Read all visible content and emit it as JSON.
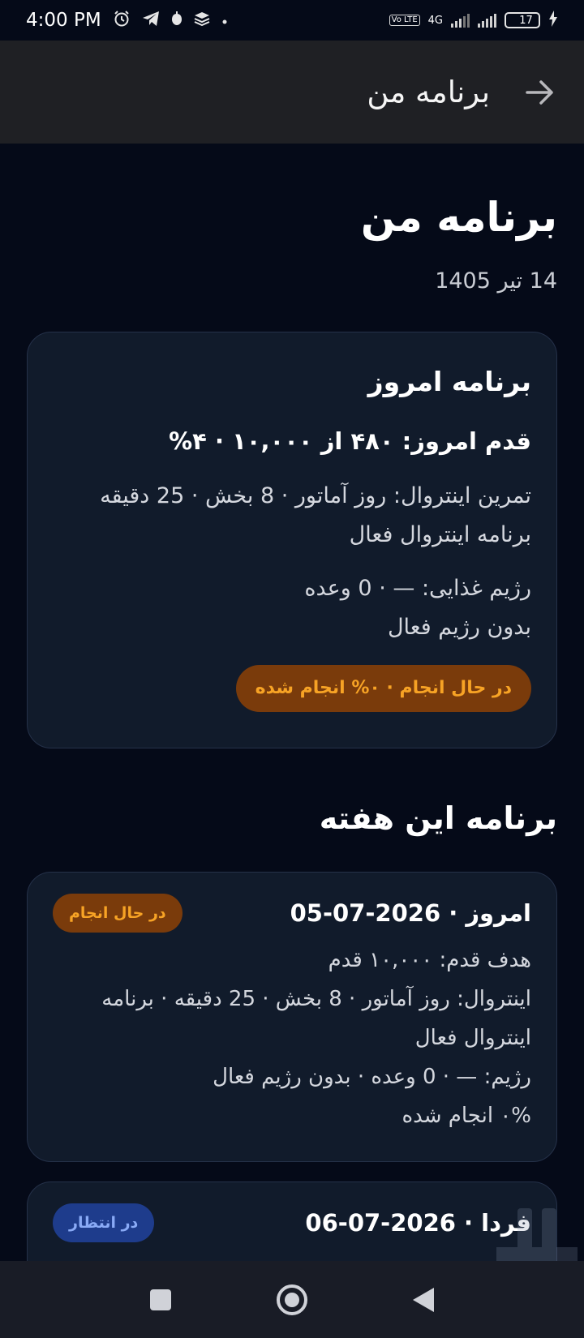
{
  "status_bar": {
    "time": "4:00 PM",
    "network": "4G",
    "lte": "Vo LTE",
    "battery": "17",
    "battery_level": 0.17
  },
  "app_bar": {
    "title": "برنامه من",
    "back_icon": "arrow-right-icon"
  },
  "header": {
    "title": "برنامه من",
    "date": "14 تیر 1405"
  },
  "today": {
    "title": "برنامه امروز",
    "steps": "قدم امروز: ۴۸۰ از ۱۰,۰۰۰ · ۴%",
    "interval_line1": "تمرین اینتروال: روز آماتور · 8 بخش · 25 دقیقه",
    "interval_line2": "برنامه اینتروال فعال",
    "diet_line1": "رژیم غذایی: — · 0 وعده",
    "diet_line2": "بدون رژیم فعال",
    "status_pill": "در حال انجام · ۰% انجام شده"
  },
  "week": {
    "title": "برنامه این هفته",
    "days": [
      {
        "title": "امروز · 2026-07-05",
        "badge": "در حال انجام",
        "lines": [
          "هدف قدم: ۱۰,۰۰۰ قدم",
          "اینتروال: روز آماتور · 8 بخش · 25 دقیقه · برنامه اینتروال فعال",
          "رژیم: — · 0 وعده · بدون رژیم فعال",
          "۰% انجام شده"
        ]
      },
      {
        "title": "فردا · 2026-07-06",
        "badge": "در انتظار"
      }
    ]
  },
  "nav": {
    "recent": "square-icon",
    "home": "circle-icon",
    "back": "triangle-back-icon"
  },
  "colors": {
    "background": "#050a18",
    "app_bar": "#1f2024",
    "card": "#111b2b",
    "warn_bg": "#7a3b0b",
    "warn_text": "#f7a325",
    "wait_bg": "#1e3c8c",
    "wait_text": "#89aaf6"
  }
}
